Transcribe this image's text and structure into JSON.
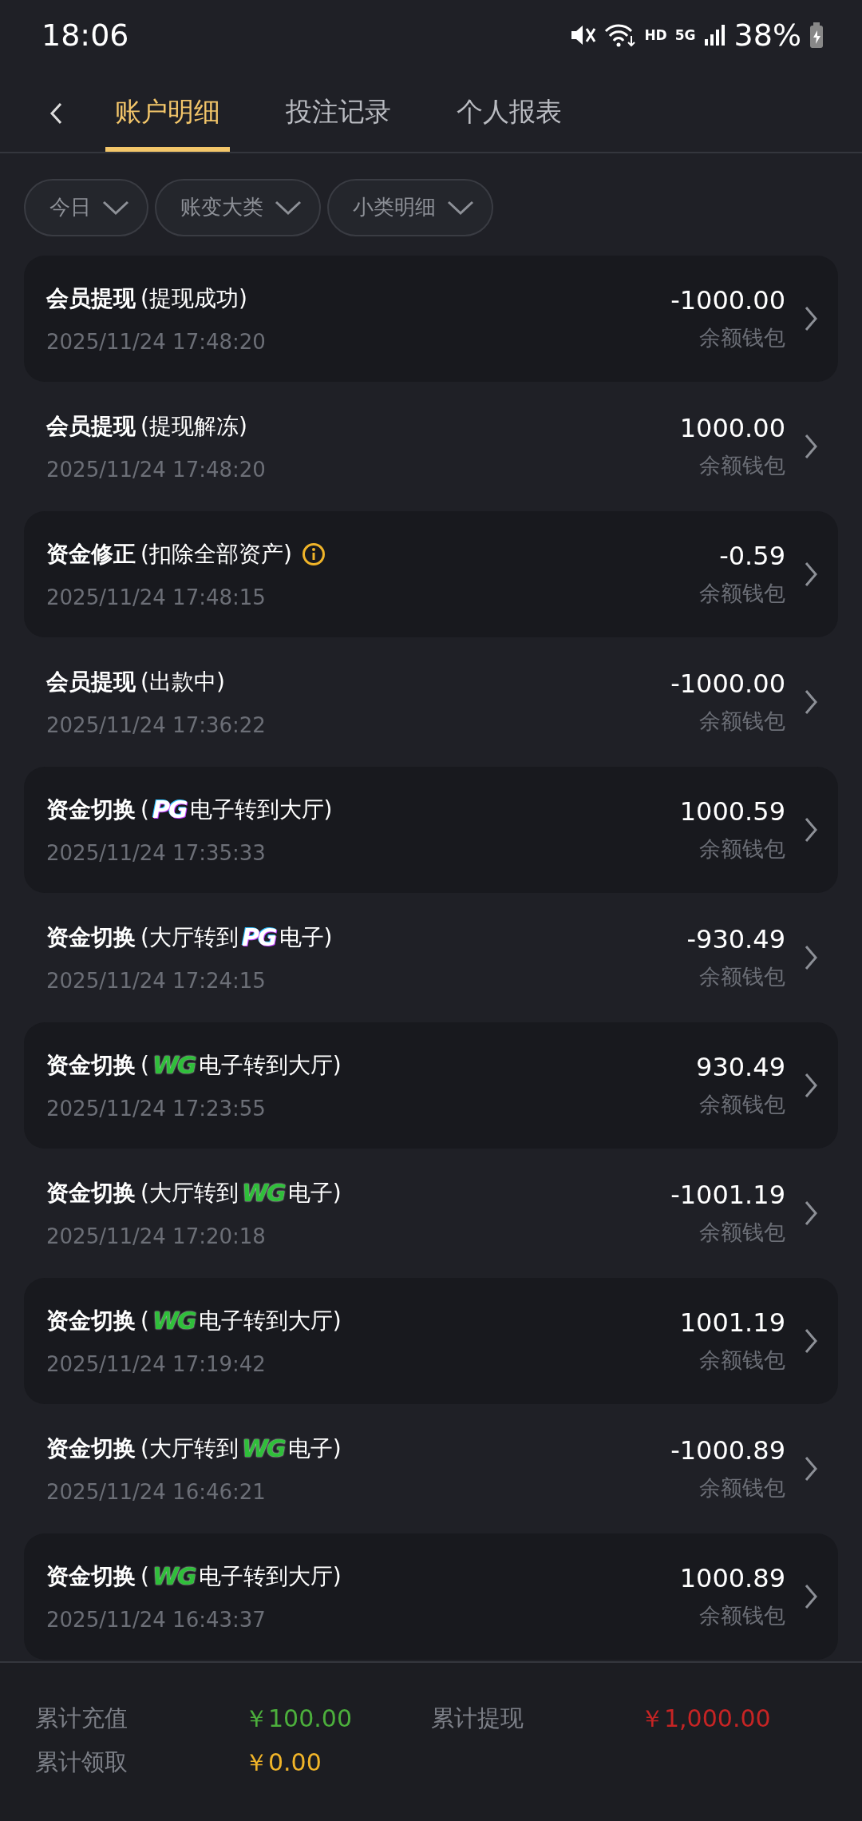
{
  "status_bar": {
    "time": "18:06",
    "network_labels": [
      "HD",
      "5G"
    ],
    "battery": "38%"
  },
  "tabs": [
    {
      "label": "账户明细",
      "selected": true
    },
    {
      "label": "投注记录",
      "selected": false
    },
    {
      "label": "个人报表",
      "selected": false
    }
  ],
  "filters": [
    {
      "label": "今日"
    },
    {
      "label": "账变大类"
    },
    {
      "label": "小类明细"
    }
  ],
  "transactions": [
    {
      "category": "会员提现",
      "before": "(提现成功)",
      "time": "2025/11/24 17:48:20",
      "amount": "-1000.00",
      "wallet": "余额钱包",
      "info": false
    },
    {
      "category": "会员提现",
      "before": "(提现解冻)",
      "time": "2025/11/24 17:48:20",
      "amount": "1000.00",
      "wallet": "余额钱包",
      "info": false
    },
    {
      "category": "资金修正",
      "before": "(扣除全部资产)",
      "time": "2025/11/24 17:48:15",
      "amount": "-0.59",
      "wallet": "余额钱包",
      "info": true
    },
    {
      "category": "会员提现",
      "before": "(出款中)",
      "time": "2025/11/24 17:36:22",
      "amount": "-1000.00",
      "wallet": "余额钱包",
      "info": false
    },
    {
      "category": "资金切换",
      "before": "(",
      "logo": "PG",
      "after": "电子转到大厅)",
      "time": "2025/11/24 17:35:33",
      "amount": "1000.59",
      "wallet": "余额钱包",
      "info": false
    },
    {
      "category": "资金切换",
      "before": "(大厅转到",
      "logo": "PG",
      "after": "电子)",
      "time": "2025/11/24 17:24:15",
      "amount": "-930.49",
      "wallet": "余额钱包",
      "info": false
    },
    {
      "category": "资金切换",
      "before": "(",
      "logo": "WG",
      "after": "电子转到大厅)",
      "time": "2025/11/24 17:23:55",
      "amount": "930.49",
      "wallet": "余额钱包",
      "info": false
    },
    {
      "category": "资金切换",
      "before": "(大厅转到",
      "logo": "WG",
      "after": "电子)",
      "time": "2025/11/24 17:20:18",
      "amount": "-1001.19",
      "wallet": "余额钱包",
      "info": false
    },
    {
      "category": "资金切换",
      "before": "(",
      "logo": "WG",
      "after": "电子转到大厅)",
      "time": "2025/11/24 17:19:42",
      "amount": "1001.19",
      "wallet": "余额钱包",
      "info": false
    },
    {
      "category": "资金切换",
      "before": "(大厅转到",
      "logo": "WG",
      "after": "电子)",
      "time": "2025/11/24 16:46:21",
      "amount": "-1000.89",
      "wallet": "余额钱包",
      "info": false
    },
    {
      "category": "资金切换",
      "before": "(",
      "logo": "WG",
      "after": "电子转到大厅)",
      "time": "2025/11/24 16:43:37",
      "amount": "1000.89",
      "wallet": "余额钱包",
      "info": false
    }
  ],
  "summary": [
    {
      "label": "累计充值",
      "value": "￥100.00",
      "color": "#4caf3c"
    },
    {
      "label": "累计提现",
      "value": "￥1,000.00",
      "color": "#c62424"
    },
    {
      "label": "累计领取",
      "value": "￥0.00",
      "color": "#f0b429"
    }
  ]
}
